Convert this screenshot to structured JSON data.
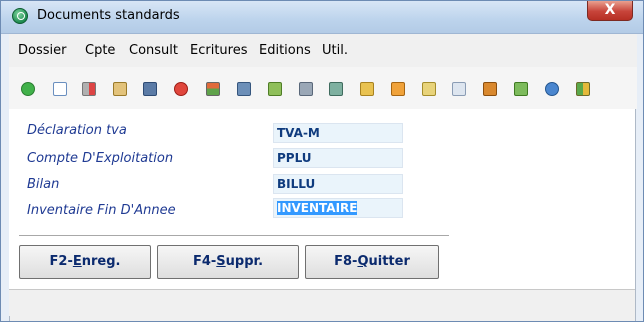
{
  "window": {
    "title": "Documents standards",
    "close_label": "X"
  },
  "menu": [
    "Dossier",
    "Cpte",
    "Consult",
    "Ecritures",
    "Editions",
    "Util."
  ],
  "toolbar": {
    "icons": [
      "check-icon",
      "new-document-icon",
      "cut-icon",
      "paste-icon",
      "print-preview-icon",
      "stop-icon",
      "home-icon",
      "help-question-icon",
      "search-icon",
      "printer-icon",
      "export-icon",
      "notes-icon",
      "save-icon",
      "folder-icon",
      "document-icon",
      "archive-icon",
      "settings-icon",
      "info-icon",
      "grid-icon"
    ]
  },
  "form": {
    "rows": [
      {
        "label": "Déclaration tva",
        "value": "TVA-M"
      },
      {
        "label": "Compte D'Exploitation",
        "value": "PPLU"
      },
      {
        "label": "Bilan",
        "value": "BILLU"
      },
      {
        "label": "Inventaire Fin D'Annee",
        "value": "INVENTAIRE"
      }
    ]
  },
  "buttons": {
    "save": {
      "prefix": "F2-",
      "underline": "E",
      "rest": "nreg."
    },
    "delete": {
      "prefix": "F4-",
      "underline": "S",
      "rest": "uppr."
    },
    "quit": {
      "prefix": "F8-",
      "underline": "Q",
      "rest": "uitter"
    }
  },
  "colors": {
    "label": "#1f3a93",
    "field_bg": "#eaf4fb",
    "selection": "#3399ff",
    "title_bar": "#bcd3ec"
  }
}
